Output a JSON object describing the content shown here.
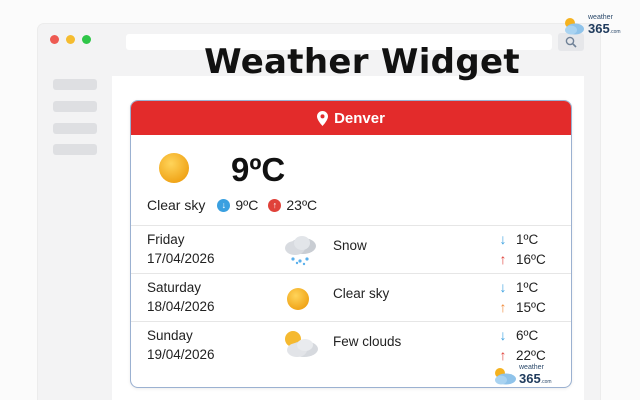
{
  "page": {
    "title": "Weather Widget"
  },
  "brand": {
    "word": "weather",
    "number": "365",
    "suffix": ".com"
  },
  "widget": {
    "location": "Denver",
    "current": {
      "temperature": "9ºC",
      "condition": "Clear sky",
      "min": "9ºC",
      "max": "23ºC",
      "icon": "sun-icon"
    },
    "forecast": [
      {
        "day": "Friday",
        "date": "17/04/2026",
        "condition": "Snow",
        "min": "1ºC",
        "max": "16ºC",
        "icon": "snow-cloud-icon"
      },
      {
        "day": "Saturday",
        "date": "18/04/2026",
        "condition": "Clear sky",
        "min": "1ºC",
        "max": "15ºC",
        "icon": "sun-icon"
      },
      {
        "day": "Sunday",
        "date": "19/04/2026",
        "condition": "Few clouds",
        "min": "6ºC",
        "max": "22ºC",
        "icon": "partly-cloudy-icon"
      }
    ]
  },
  "colors": {
    "header_red": "#e32b2b",
    "min_arrow": "#3aa0e0",
    "max_arrow": "#e0423a",
    "max_arrow_warm": "#f08a3a",
    "sun": "#f5b21f"
  }
}
